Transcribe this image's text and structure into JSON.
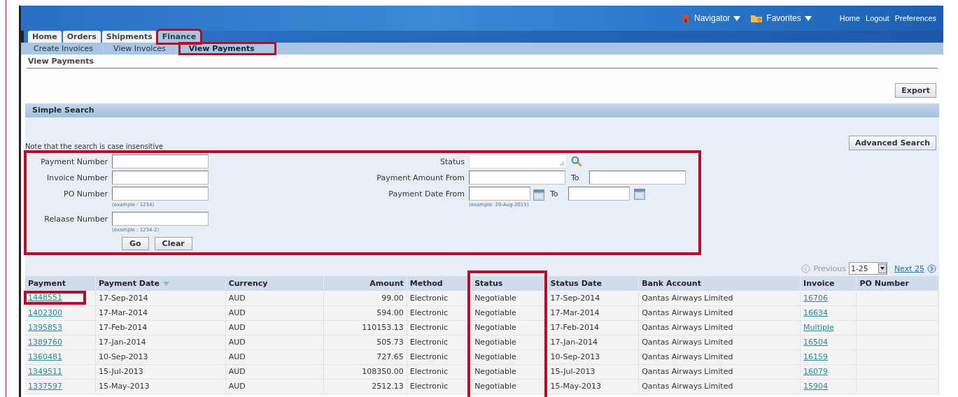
{
  "header": {
    "menus": [
      {
        "label": "Navigator"
      },
      {
        "label": "Favorites"
      }
    ],
    "links": [
      "Home",
      "Logout",
      "Preferences"
    ]
  },
  "tabs": [
    {
      "label": "Home",
      "selected": false,
      "highlighted": false
    },
    {
      "label": "Orders",
      "selected": false,
      "highlighted": false
    },
    {
      "label": "Shipments",
      "selected": false,
      "highlighted": false
    },
    {
      "label": "Finance",
      "selected": true,
      "highlighted": true
    }
  ],
  "subtabs": [
    {
      "label": "Create Invoices",
      "selected": false,
      "highlighted": false
    },
    {
      "label": "View Invoices",
      "selected": false,
      "highlighted": false
    },
    {
      "label": "View Payments",
      "selected": true,
      "highlighted": true
    }
  ],
  "page_title": "View Payments",
  "export_button": "Export",
  "search": {
    "title": "Simple Search",
    "note": "Note that the search is case insensitive",
    "advanced_button": "Advanced Search",
    "highlighted": true,
    "left_fields": [
      {
        "label": "Payment Number"
      },
      {
        "label": "Invoice Number"
      },
      {
        "label": "PO Number",
        "hint": "(example : 1234)"
      },
      {
        "label": "Relaase Number",
        "hint": "(example : 1234-2)"
      }
    ],
    "status": {
      "label": "Status"
    },
    "amount": {
      "label": "Payment Amount From",
      "to_label": "To"
    },
    "date": {
      "label": "Payment Date From",
      "to_label": "To",
      "hint": "(example: 20-Aug-2015)"
    },
    "buttons": [
      "Go",
      "Clear"
    ]
  },
  "pagination": {
    "previous": "Previous",
    "range": "1-25",
    "next": "Next 25"
  },
  "table": {
    "columns": [
      {
        "label": "Payment",
        "kind": "link",
        "sorted": false,
        "highlighted": false
      },
      {
        "label": "Payment Date",
        "kind": "text",
        "sorted": true,
        "highlighted": false
      },
      {
        "label": "Currency",
        "kind": "text",
        "sorted": false,
        "highlighted": false
      },
      {
        "label": "Amount",
        "kind": "number",
        "sorted": false,
        "highlighted": false
      },
      {
        "label": "Method",
        "kind": "text",
        "sorted": false,
        "highlighted": false
      },
      {
        "label": "Status",
        "kind": "text",
        "sorted": false,
        "highlighted": true
      },
      {
        "label": "Status Date",
        "kind": "text",
        "sorted": false,
        "highlighted": false
      },
      {
        "label": "Bank Account",
        "kind": "text",
        "sorted": false,
        "highlighted": false
      },
      {
        "label": "Invoice",
        "kind": "link",
        "sorted": false,
        "highlighted": false
      },
      {
        "label": "PO Number",
        "kind": "text",
        "sorted": false,
        "highlighted": false
      }
    ],
    "rows": [
      {
        "highlighted_first": true,
        "cells": [
          "1448551",
          "17-Sep-2014",
          "AUD",
          "99.00",
          "Electronic",
          "Negotiable",
          "17-Sep-2014",
          "Qantas Airways Limited",
          "16706",
          ""
        ]
      },
      {
        "highlighted_first": false,
        "cells": [
          "1402300",
          "17-Mar-2014",
          "AUD",
          "594.00",
          "Electronic",
          "Negotiable",
          "17-Mar-2014",
          "Qantas Airways Limited",
          "16634",
          ""
        ]
      },
      {
        "highlighted_first": false,
        "cells": [
          "1395853",
          "17-Feb-2014",
          "AUD",
          "110153.13",
          "Electronic",
          "Negotiable",
          "17-Feb-2014",
          "Qantas Airways Limited",
          "Multiple",
          ""
        ]
      },
      {
        "highlighted_first": false,
        "cells": [
          "1389760",
          "17-Jan-2014",
          "AUD",
          "505.73",
          "Electronic",
          "Negotiable",
          "17-Jan-2014",
          "Qantas Airways Limited",
          "16504",
          ""
        ]
      },
      {
        "highlighted_first": false,
        "cells": [
          "1360481",
          "10-Sep-2013",
          "AUD",
          "727.65",
          "Electronic",
          "Negotiable",
          "10-Sep-2013",
          "Qantas Airways Limited",
          "16159",
          ""
        ]
      },
      {
        "highlighted_first": false,
        "cells": [
          "1349511",
          "15-Jul-2013",
          "AUD",
          "108350.00",
          "Electronic",
          "Negotiable",
          "15-Jul-2013",
          "Qantas Airways Limited",
          "16079",
          ""
        ]
      },
      {
        "highlighted_first": false,
        "cells": [
          "1337597",
          "15-May-2013",
          "AUD",
          "2512.13",
          "Electronic",
          "Negotiable",
          "15-May-2013",
          "Qantas Airways Limited",
          "15904",
          ""
        ]
      }
    ]
  }
}
